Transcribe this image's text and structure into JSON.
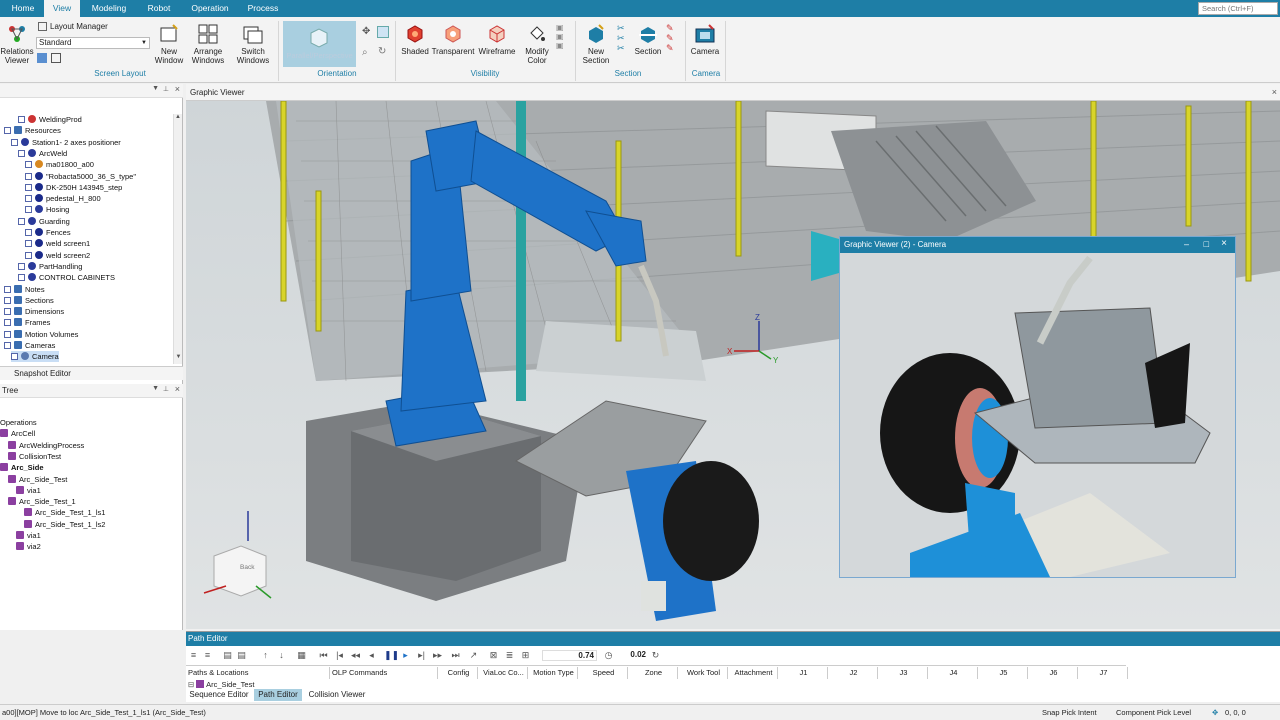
{
  "menu": {
    "tabs": [
      "Home",
      "View",
      "Modeling",
      "Robot",
      "Operation",
      "Process"
    ],
    "active": "View",
    "search_placeholder": "Search (Ctrl+F)"
  },
  "ribbon": {
    "relations_viewer": "Relations\nViewer",
    "layout_manager": "Layout Manager",
    "layout_value": "Standard",
    "new_window": "New\nWindow",
    "arrange_windows": "Arrange\nWindows",
    "switch_windows": "Switch\nWindows",
    "screen_layout_group": "Screen Layout",
    "orientation_group": "Orientation",
    "parallel_perspective": "Parallel/Perspective",
    "shaded": "Shaded",
    "transparent": "Transparent",
    "wireframe": "Wireframe",
    "modify_color": "Modify\nColor",
    "visibility_group": "Visibility",
    "new_section": "New\nSection",
    "section": "Section",
    "section_group": "Section",
    "camera": "Camera",
    "camera_group": "Camera"
  },
  "object_tree": {
    "items": [
      {
        "label": "WeldingProd",
        "indent": 2,
        "icon": "play-icon"
      },
      {
        "label": "Resources",
        "indent": 0,
        "icon": "folder-icon"
      },
      {
        "label": "Station1- 2 axes positioner",
        "indent": 1,
        "icon": "station-icon"
      },
      {
        "label": "ArcWeld",
        "indent": 2,
        "icon": "station-icon"
      },
      {
        "label": "ma01800_a00",
        "indent": 3,
        "icon": "robot-icon"
      },
      {
        "label": "\"Robacta5000_36_S_type\"",
        "indent": 3,
        "icon": "part-icon"
      },
      {
        "label": "DK-250H 143945_step",
        "indent": 3,
        "icon": "part-icon"
      },
      {
        "label": "pedestal_H_800",
        "indent": 3,
        "icon": "part-icon"
      },
      {
        "label": "Hosing",
        "indent": 3,
        "icon": "station-icon"
      },
      {
        "label": "Guarding",
        "indent": 2,
        "icon": "station-icon"
      },
      {
        "label": "Fences",
        "indent": 3,
        "icon": "part-icon"
      },
      {
        "label": "weld screen1",
        "indent": 3,
        "icon": "part-icon"
      },
      {
        "label": "weld screen2",
        "indent": 3,
        "icon": "part-icon"
      },
      {
        "label": "PartHandling",
        "indent": 2,
        "icon": "station-icon"
      },
      {
        "label": "CONTROL CABINETS",
        "indent": 2,
        "icon": "station-icon"
      },
      {
        "label": "Notes",
        "indent": 0,
        "icon": "folder-icon"
      },
      {
        "label": "Sections",
        "indent": 0,
        "icon": "folder-icon"
      },
      {
        "label": "Dimensions",
        "indent": 0,
        "icon": "folder-icon"
      },
      {
        "label": "Frames",
        "indent": 0,
        "icon": "folder-icon"
      },
      {
        "label": "Motion Volumes",
        "indent": 0,
        "icon": "folder-icon"
      },
      {
        "label": "Cameras",
        "indent": 0,
        "icon": "folder-icon"
      },
      {
        "label": "Camera",
        "indent": 1,
        "icon": "camera-icon",
        "selected": true
      }
    ],
    "snapshot_editor": "Snapshot Editor"
  },
  "operation_tree": {
    "title": "Tree",
    "items": [
      {
        "label": "Operations",
        "indent": 0
      },
      {
        "label": "ArcCell",
        "indent": 0
      },
      {
        "label": "ArcWeldingProcess",
        "indent": 1
      },
      {
        "label": "CollisionTest",
        "indent": 1
      },
      {
        "label": "Arc_Side",
        "indent": 0,
        "bold": true
      },
      {
        "label": "Arc_Side_Test",
        "indent": 1
      },
      {
        "label": "via1",
        "indent": 2
      },
      {
        "label": "Arc_Side_Test_1",
        "indent": 1
      },
      {
        "label": "Arc_Side_Test_1_ls1",
        "indent": 3
      },
      {
        "label": "Arc_Side_Test_1_ls2",
        "indent": 3
      },
      {
        "label": "via1",
        "indent": 2
      },
      {
        "label": "via2",
        "indent": 2
      }
    ]
  },
  "graphic_viewer": {
    "title": "Graphic Viewer",
    "axis_x": "X",
    "axis_y": "Y",
    "axis_z": "Z",
    "cube_face": "Back"
  },
  "camera_viewer": {
    "title": "Graphic Viewer (2) - Camera"
  },
  "path_editor": {
    "title": "Path Editor",
    "speed_value": "0.74",
    "time_value": "0.02",
    "columns": [
      "Paths & Locations",
      "OLP Commands",
      "Config",
      "ViaLoc Co...",
      "Motion Type",
      "Speed",
      "Zone",
      "Work Tool",
      "Attachment",
      "J1",
      "J2",
      "J3",
      "J4",
      "J5",
      "J6",
      "J7"
    ],
    "row": "Arc_Side_Test",
    "tabs": [
      "Sequence Editor",
      "Path Editor",
      "Collision Viewer"
    ],
    "active_tab": "Path Editor"
  },
  "status": {
    "message": "a00][MOP] Move to loc Arc_Side_Test_1_ls1 (Arc_Side_Test)",
    "snap": "Snap Pick Intent",
    "pick_level": "Component Pick Level",
    "coords": "0, 0, 0"
  },
  "colors": {
    "accent": "#1e7ea6",
    "robot_blue": "#1e72c8",
    "fence_yellow": "#d8d42a"
  }
}
